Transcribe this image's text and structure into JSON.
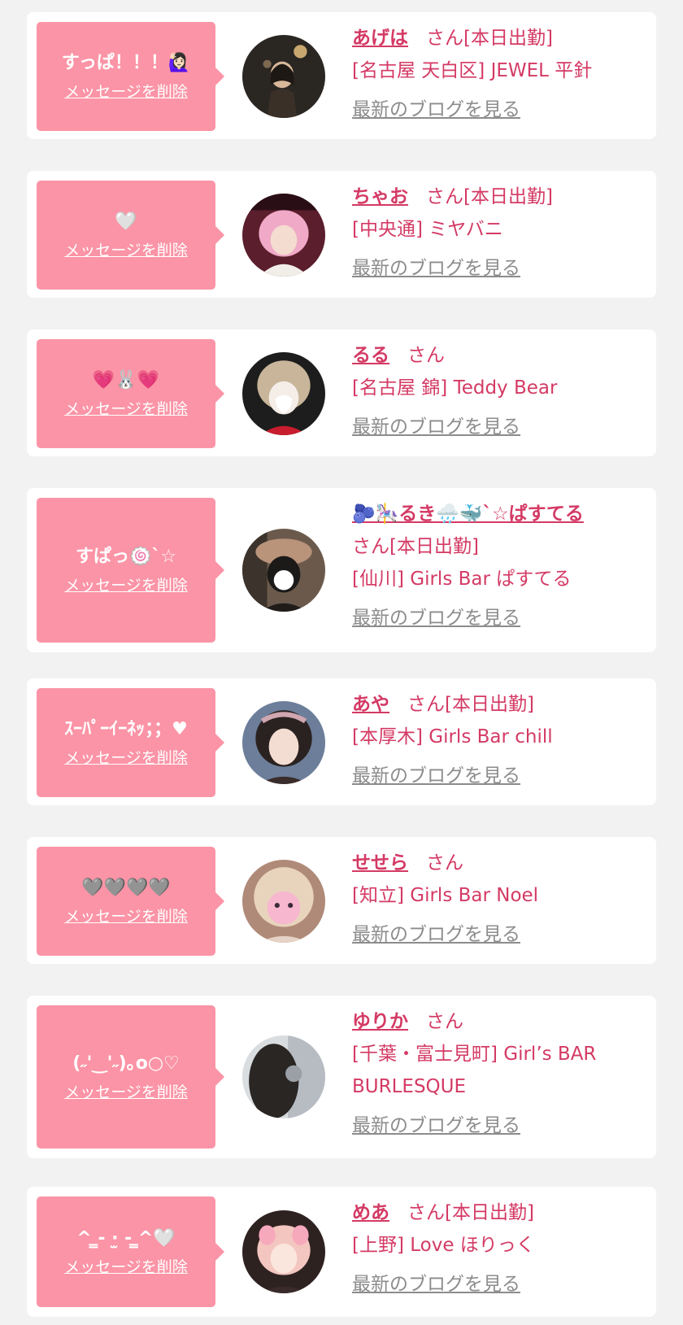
{
  "delete_label": "メッセージを削除",
  "blog_label": "最新のブログを見る",
  "colors": {
    "bubble": "#fb94a6",
    "accent": "#d43a64",
    "muted": "#8c8c8c",
    "background": "#f2f2f2"
  },
  "cards": [
    {
      "message": "すっぱ！！！🙋🏻‍♀️",
      "name": "あげは",
      "suffix": "さん[本日出勤]",
      "shop": "[名古屋 天白区] JEWEL 平針",
      "avatar_icon": "avatar-photo"
    },
    {
      "message": "🤍",
      "name": "ちゃお",
      "suffix": "さん[本日出勤]",
      "shop": "[中央通] ミヤバニ",
      "avatar_icon": "avatar-photo"
    },
    {
      "message": "💗🐰💗",
      "name": "るる",
      "suffix": "さん",
      "shop": "[名古屋 錦] Teddy Bear",
      "avatar_icon": "avatar-photo"
    },
    {
      "message": "すぱっ🍥`☆",
      "name": "🫐🎠るき🌧️🐳`☆ぱすてる",
      "suffix": "さん[本日出勤]",
      "shop": "[仙川] Girls Bar ぱすてる",
      "avatar_icon": "avatar-photo"
    },
    {
      "message": "ｽｰﾊﾟｰｲｰﾈｯ；；♥",
      "name": "あや",
      "suffix": "さん[本日出勤]",
      "shop": "[本厚木] Girls Bar chill",
      "avatar_icon": "avatar-photo"
    },
    {
      "message": "🩶🩶🩶🩶",
      "name": "せせら",
      "suffix": "さん",
      "shop": "[知立] Girls Bar Noel",
      "avatar_icon": "avatar-photo"
    },
    {
      "message": "(˶'‿'˶)｡o○♡",
      "name": "ゆりか",
      "suffix": "さん",
      "shop": "[千葉・富士見町] Girl’s BAR BURLESQUE",
      "avatar_icon": "avatar-photo"
    },
    {
      "message": "^ ̳- ·̫ - ̳^🤍",
      "name": "めあ",
      "suffix": "さん[本日出勤]",
      "shop": "[上野] Love ほりっく",
      "avatar_icon": "avatar-photo"
    }
  ]
}
